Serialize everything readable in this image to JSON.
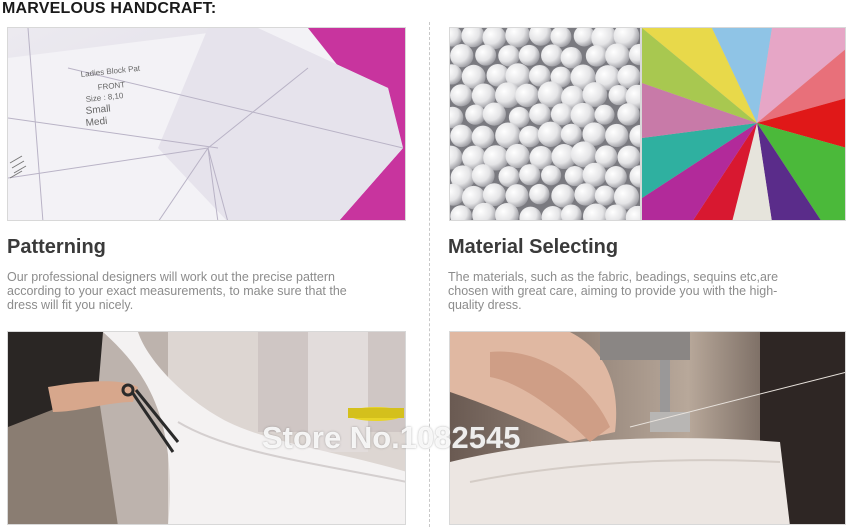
{
  "section_heading": "MARVELOUS HANDCRAFT:",
  "blocks": [
    {
      "title": "Patterning",
      "description_lines": [
        "Our professional designers will work out the precise pattern",
        "according to your exact measurements, to make sure that the",
        "dress will fit you nicely."
      ]
    },
    {
      "title": "Material Selecting",
      "description_lines": [
        "The materials, such as the fabric, beadings, sequins etc,are",
        "chosen with great care, aiming to provide you with the high-",
        "quality dress."
      ]
    }
  ],
  "pattern_sheet_text": [
    "Ladies Block Pat",
    "FRONT",
    "Size : 8,10",
    "Small",
    "Medi"
  ],
  "watermark": "Store No.1082545",
  "colors": {
    "heading": "#1a1a1a",
    "title": "#3a3a3a",
    "description": "#8c8c8c",
    "magenta_paper": "#c8349e"
  }
}
